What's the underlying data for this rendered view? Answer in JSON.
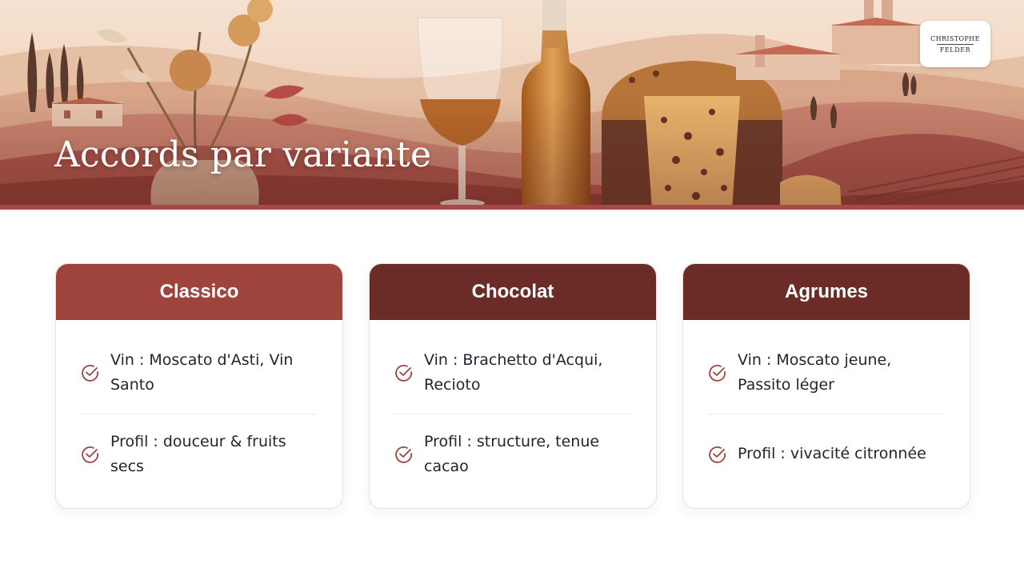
{
  "header": {
    "title": "Accords par variante",
    "logo": {
      "line1": "CHRISTOPHE",
      "line2": "FELDER"
    }
  },
  "colors": {
    "classico_header": "#9e443d",
    "chocolat_header": "#6b2b27",
    "agrumes_header": "#6b2b27",
    "accent_line": "#a84a43",
    "check_icon": "#9e443d"
  },
  "cards": [
    {
      "title": "Classico",
      "items": [
        {
          "text_line1": "Vin : Moscato d'Asti, Vin",
          "text_line2": "Santo",
          "icon": "check-circle-icon"
        },
        {
          "text_line1": "Profil : douceur & fruits",
          "text_line2": "secs",
          "icon": "check-circle-icon"
        }
      ]
    },
    {
      "title": "Chocolat",
      "items": [
        {
          "text_line1": "Vin : Brachetto d'Acqui,",
          "text_line2": "Recioto",
          "icon": "check-circle-icon"
        },
        {
          "text_line1": "Profil : structure, tenue",
          "text_line2": "cacao",
          "icon": "check-circle-icon"
        }
      ]
    },
    {
      "title": "Agrumes",
      "items": [
        {
          "text_line1": "Vin : Moscato jeune,",
          "text_line2": "Passito léger",
          "icon": "check-circle-icon"
        },
        {
          "text_line1": "Profil : vivacité citronnée",
          "text_line2": "",
          "icon": "check-circle-icon"
        }
      ]
    }
  ]
}
